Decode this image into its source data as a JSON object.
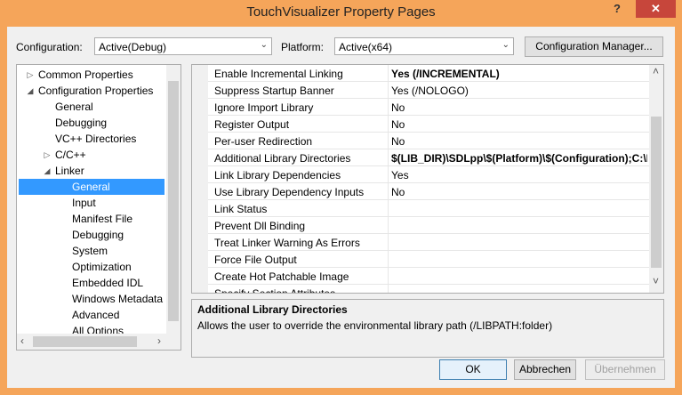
{
  "window": {
    "title": "TouchVisualizer Property Pages",
    "help_label": "?",
    "close_label": "✕"
  },
  "toolbar": {
    "configuration_label": "Configuration:",
    "configuration_value": "Active(Debug)",
    "platform_label": "Platform:",
    "platform_value": "Active(x64)",
    "config_manager_label": "Configuration Manager..."
  },
  "tree": {
    "items": [
      {
        "label": "Common Properties",
        "expander": "▷"
      },
      {
        "label": "Configuration Properties",
        "expander": "◢"
      },
      {
        "label": "General",
        "expander": ""
      },
      {
        "label": "Debugging",
        "expander": ""
      },
      {
        "label": "VC++ Directories",
        "expander": ""
      },
      {
        "label": "C/C++",
        "expander": "▷"
      },
      {
        "label": "Linker",
        "expander": "◢"
      },
      {
        "label": "General",
        "expander": ""
      },
      {
        "label": "Input",
        "expander": ""
      },
      {
        "label": "Manifest File",
        "expander": ""
      },
      {
        "label": "Debugging",
        "expander": ""
      },
      {
        "label": "System",
        "expander": ""
      },
      {
        "label": "Optimization",
        "expander": ""
      },
      {
        "label": "Embedded IDL",
        "expander": ""
      },
      {
        "label": "Windows Metadata",
        "expander": ""
      },
      {
        "label": "Advanced",
        "expander": ""
      },
      {
        "label": "All Options",
        "expander": ""
      }
    ],
    "selected_item": "General"
  },
  "grid": {
    "rows": [
      {
        "name": "Enable Incremental Linking",
        "value": "Yes (/INCREMENTAL)"
      },
      {
        "name": "Suppress Startup Banner",
        "value": "Yes (/NOLOGO)"
      },
      {
        "name": "Ignore Import Library",
        "value": "No"
      },
      {
        "name": "Register Output",
        "value": "No"
      },
      {
        "name": "Per-user Redirection",
        "value": "No"
      },
      {
        "name": "Additional Library Directories",
        "value": "$(LIB_DIR)\\SDLpp\\$(Platform)\\$(Configuration);C:\\P"
      },
      {
        "name": "Link Library Dependencies",
        "value": "Yes"
      },
      {
        "name": "Use Library Dependency Inputs",
        "value": "No"
      },
      {
        "name": "Link Status",
        "value": ""
      },
      {
        "name": "Prevent Dll Binding",
        "value": ""
      },
      {
        "name": "Treat Linker Warning As Errors",
        "value": ""
      },
      {
        "name": "Force File Output",
        "value": ""
      },
      {
        "name": "Create Hot Patchable Image",
        "value": ""
      },
      {
        "name": "Specify Section Attributes",
        "value": ""
      }
    ]
  },
  "description": {
    "title": "Additional Library Directories",
    "text": "Allows the user to override the environmental library path (/LIBPATH:folder)"
  },
  "buttons": {
    "ok": "OK",
    "cancel": "Abbrechen",
    "apply": "Übernehmen"
  },
  "glyphs": {
    "combo_arrow": "⌄",
    "scroll_up": "˄",
    "scroll_down": "˅",
    "scroll_left": "‹",
    "scroll_right": "›"
  }
}
